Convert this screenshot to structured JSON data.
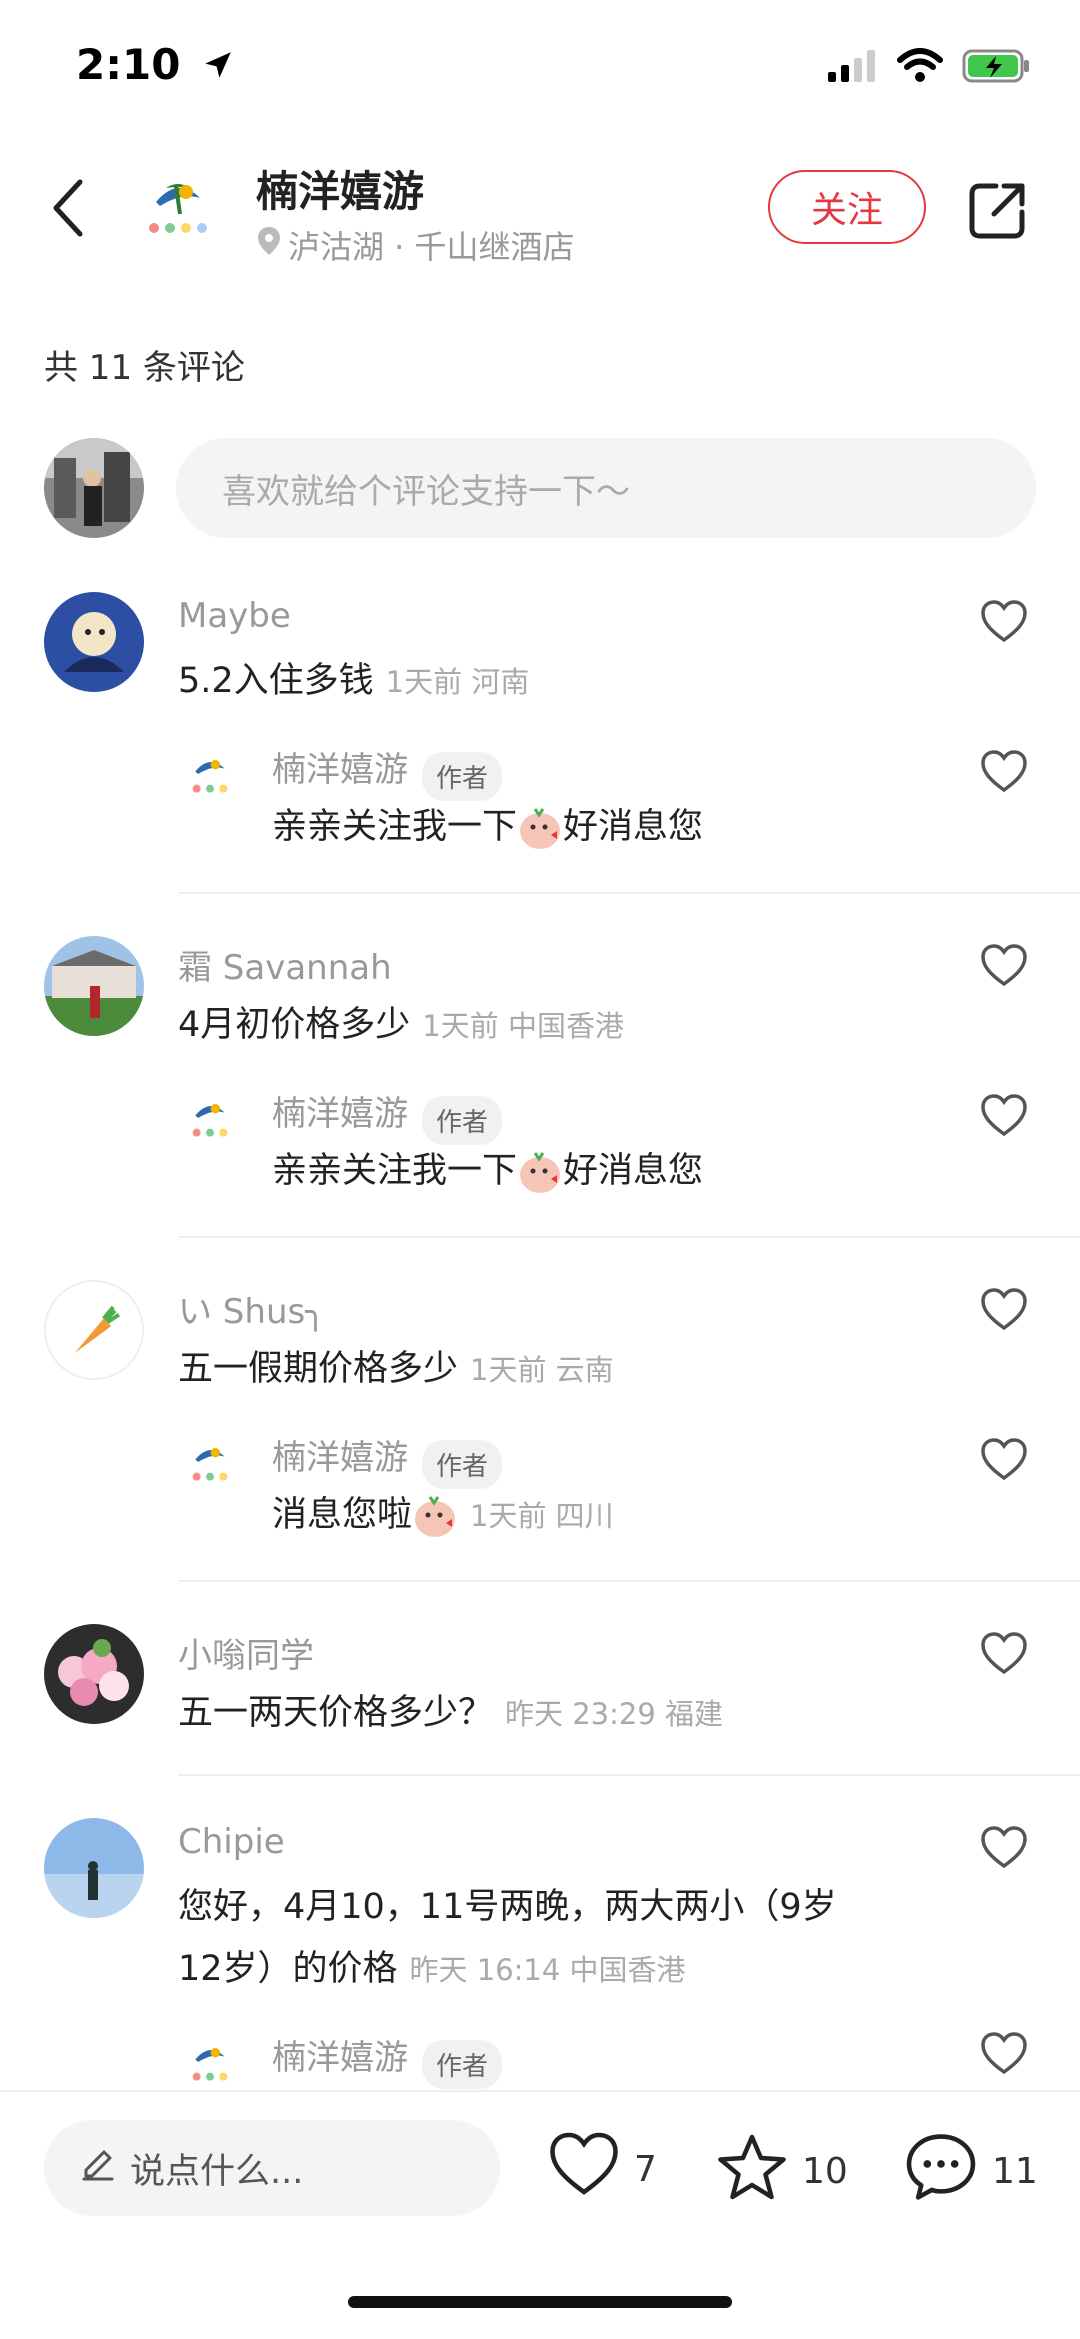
{
  "status": {
    "time": "2:10"
  },
  "header": {
    "name": "楠洋嬉游",
    "location": "泸沽湖 · 千山继酒店",
    "follow_label": "关注"
  },
  "comments_count_label": "共 11 条评论",
  "input": {
    "placeholder": "喜欢就给个评论支持一下～"
  },
  "comments": [
    {
      "user": "Maybe",
      "text": "5.2入住多钱",
      "meta": "1天前 河南",
      "reply": {
        "user": "楠洋嬉游",
        "tag": "作者",
        "text_a": "亲亲关注我一下",
        "text_b": "好消息您"
      }
    },
    {
      "user": "霜 Savannah",
      "text": "4月初价格多少",
      "meta": "1天前 中国香港",
      "reply": {
        "user": "楠洋嬉游",
        "tag": "作者",
        "text_a": "亲亲关注我一下",
        "text_b": "好消息您"
      }
    },
    {
      "user": "い Shus╮",
      "text": "五一假期价格多少",
      "meta": "1天前 云南",
      "reply": {
        "user": "楠洋嬉游",
        "tag": "作者",
        "text_a": "消息您啦",
        "meta": "1天前 四川"
      }
    },
    {
      "user": "小嗡同学",
      "text": "五一两天价格多少？",
      "meta": "昨天 23:29 福建"
    },
    {
      "user": "Chipie",
      "text_line1": "您好，4月10，11号两晚，两大两小（9岁",
      "text_line2": "12岁）的价格",
      "meta": "昨天 16:14 中国香港",
      "reply": {
        "user": "楠洋嬉游",
        "tag": "作者"
      }
    }
  ],
  "bottom": {
    "say_placeholder": "说点什么...",
    "likes": "7",
    "stars": "10",
    "comments": "11"
  },
  "colors": {
    "accent": "#e5393f",
    "muted": "#999999",
    "input_bg": "#f4f4f4"
  }
}
